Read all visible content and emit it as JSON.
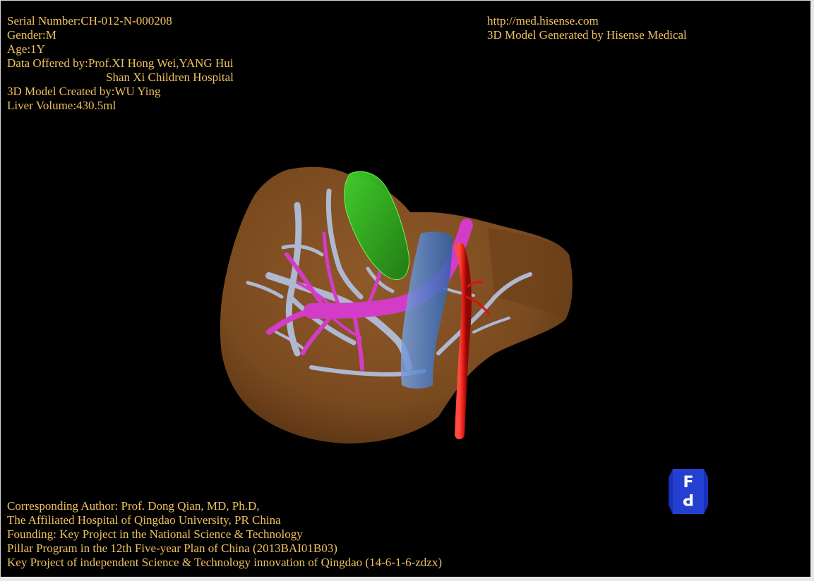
{
  "colors": {
    "background": "#000000",
    "overlay_text": "#f0c060",
    "liver": "#7a4a1f",
    "liver_highlight": "#8f5a2a",
    "gallbladder": "#2fae1f",
    "portal_vein": "#d43cc8",
    "hepatic_vein": "#aeb8d0",
    "vena_cava": "#4f7fc8",
    "artery": "#d8140e",
    "cube_face": "#1830b8",
    "cube_letter": "#ffffff"
  },
  "header_left": {
    "serial": "Serial Number:CH-012-N-000208",
    "gender": "Gender:M",
    "age": "Age:1Y",
    "data_offered": "Data Offered by:Prof.XI Hong Wei,YANG Hui",
    "hospital": "Shan Xi Children Hospital",
    "created_by": "3D Model Created by:WU Ying",
    "liver_volume": "Liver Volume:430.5ml"
  },
  "header_right": {
    "url": "http://med.hisense.com",
    "generated_by": "3D Model Generated by Hisense Medical"
  },
  "footer": {
    "author": "Corresponding Author: Prof. Dong Qian, MD, Ph.D,",
    "affiliation": "The Affiliated Hospital of Qingdao University, PR China",
    "founding": "Founding: Key Project in the National Science & Technology",
    "pillar": "Pillar Program in the 12th Five-year Plan of China (2013BAI01B03)",
    "key_project": "Key Project of independent Science & Technology innovation of Qingdao (14-6-1-6-zdzx)"
  },
  "orientation_cube": {
    "front_label": "F",
    "posterior_label": "P",
    "icon": "orientation-cube-icon"
  },
  "model": {
    "icon": "liver-3d-model",
    "parts": [
      "liver",
      "gallbladder",
      "portal-vein",
      "hepatic-vein",
      "inferior-vena-cava",
      "hepatic-artery"
    ]
  }
}
